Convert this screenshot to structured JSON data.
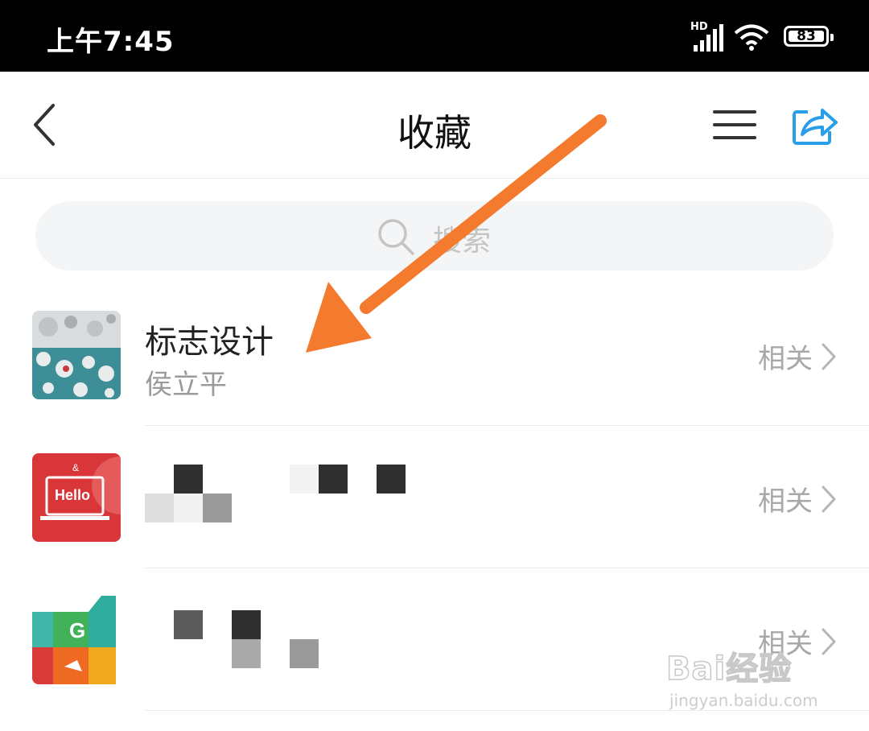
{
  "status_bar": {
    "time": "上午7:45",
    "network": "HD",
    "battery": "83"
  },
  "nav": {
    "title": "收藏",
    "back_icon": "chevron-left-icon",
    "menu_icon": "menu-icon",
    "share_icon": "share-icon"
  },
  "search": {
    "placeholder": "搜索"
  },
  "favorites": [
    {
      "title": "标志设计",
      "subtitle": "侯立平",
      "action": "相关"
    },
    {
      "title": "",
      "subtitle": "",
      "action": "相关"
    },
    {
      "title": "",
      "subtitle": "",
      "action": "相关"
    }
  ],
  "colors": {
    "accent": "#2a9ee8",
    "annotation_arrow": "#f47a2e",
    "status_bar_bg": "#000000"
  },
  "watermark": {
    "brand": "Bai经验",
    "url": "jingyan.baidu.com"
  }
}
